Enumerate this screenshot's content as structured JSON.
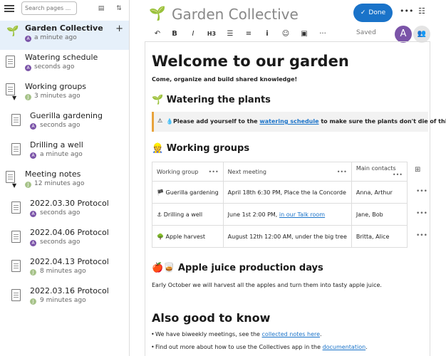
{
  "sidebar": {
    "search_placeholder": "Search pages ...",
    "pages": [
      {
        "title": "Garden Collective",
        "meta": "a minute ago",
        "avatar": "A"
      },
      {
        "title": "Watering schedule",
        "meta": "seconds ago",
        "avatar": "A"
      },
      {
        "title": "Working groups",
        "meta": "3 minutes ago",
        "avatar": "J"
      },
      {
        "title": "Guerilla gardening",
        "meta": "seconds ago",
        "avatar": "A"
      },
      {
        "title": "Drilling a well",
        "meta": "a minute ago",
        "avatar": "A"
      },
      {
        "title": "Meeting notes",
        "meta": "12 minutes ago",
        "avatar": "J"
      },
      {
        "title": "2022.03.30 Protocol",
        "meta": "seconds ago",
        "avatar": "A"
      },
      {
        "title": "2022.04.06 Protocol",
        "meta": "seconds ago",
        "avatar": "A"
      },
      {
        "title": "2022.04.13 Protocol",
        "meta": "8 minutes ago",
        "avatar": "J"
      },
      {
        "title": "2022.03.16 Protocol",
        "meta": "9 minutes ago",
        "avatar": "J"
      }
    ]
  },
  "header": {
    "title": "Garden Collective",
    "done_label": "Done",
    "saved_label": "Saved",
    "user_avatar": "A",
    "toolbar": {
      "undo": "↶",
      "bold": "B",
      "italic": "I",
      "heading": "H3",
      "bullet_list": "☰",
      "ordered_list": "≡",
      "info": "i",
      "emoji": "☺",
      "image": "▣",
      "more": "···"
    }
  },
  "doc": {
    "h1": "Welcome to our garden",
    "intro": "Come, organize and build shared knowledge!",
    "section1_title": "🌱 Watering the plants",
    "callout_pre": "💧Please add yourself to the ",
    "callout_link": "watering schedule",
    "callout_post": " to make sure the plants don't die of thirst. 💧",
    "section2_title": "👷 Working groups",
    "table": {
      "headers": [
        "Working group",
        "Next meeting",
        "Main contacts"
      ],
      "rows": [
        {
          "group": "🏴 Guerilla gardening",
          "meeting": "April 18th 6:30 PM, Place the la Concorde",
          "meeting_link": "",
          "contacts": "Anna, Arthur"
        },
        {
          "group": "⚓ Drilling a well",
          "meeting": "June 1st 2:00 PM, ",
          "meeting_link": "in our Talk room",
          "contacts": "Jane, Bob"
        },
        {
          "group": "🌳 Apple harvest",
          "meeting": "August 12th 12:00 AM, under the big tree",
          "meeting_link": "",
          "contacts": "Britta, Alice"
        }
      ]
    },
    "section3_title": "🍎🥃 Apple juice production days",
    "section3_text": "Early October we will harvest all the apples and turn them into tasty apple juice.",
    "section4_title": "Also good to know",
    "bullet1_pre": "We have biweekly meetings, see the ",
    "bullet1_link": "collected notes here",
    "bullet1_post": ".",
    "bullet2_pre": "Find out more about how to use the Collectives app in the ",
    "bullet2_link": "documentation",
    "bullet2_post": "."
  }
}
